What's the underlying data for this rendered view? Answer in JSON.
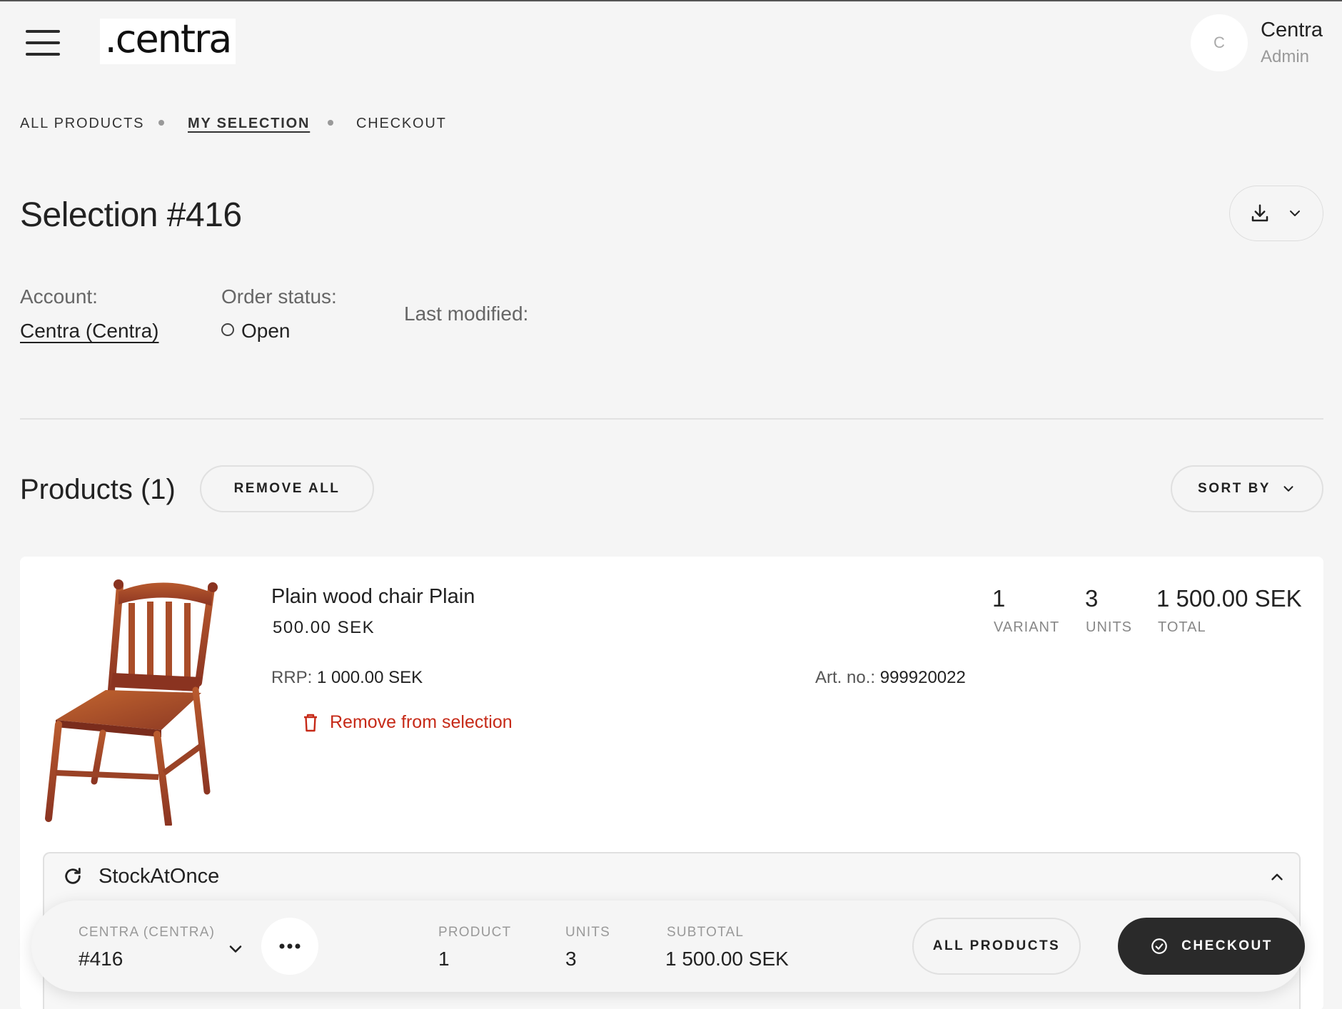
{
  "header": {
    "logo_text": ".centra",
    "avatar_initial": "C",
    "user_name": "Centra",
    "user_role": "Admin"
  },
  "breadcrumb": [
    {
      "label": "ALL PRODUCTS",
      "active": false
    },
    {
      "label": "MY SELECTION",
      "active": true
    },
    {
      "label": "CHECKOUT",
      "active": false
    }
  ],
  "page": {
    "title": "Selection #416"
  },
  "meta": {
    "account_label": "Account:",
    "account_value": "Centra (Centra)",
    "status_label": "Order status:",
    "status_value": "Open",
    "modified_label": "Last modified:"
  },
  "products": {
    "title": "Products (1)",
    "remove_all_label": "REMOVE ALL",
    "sort_by_label": "SORT BY",
    "items": [
      {
        "name": "Plain wood chair Plain",
        "price": "500.00 SEK",
        "rrp_label": "RRP:",
        "rrp_value": "1 000.00 SEK",
        "art_label": "Art. no.:",
        "art_value": "999920022",
        "remove_label": "Remove from selection",
        "variant_count": "1",
        "variant_label": "VARIANT",
        "units_count": "3",
        "units_label": "UNITS",
        "total_value": "1 500.00 SEK",
        "total_label": "TOTAL",
        "stock_title": "StockAtOnce"
      }
    ]
  },
  "bottom_bar": {
    "selection_label": "CENTRA (CENTRA)",
    "selection_value": "#416",
    "product_label": "PRODUCT",
    "product_value": "1",
    "units_label": "UNITS",
    "units_value": "3",
    "subtotal_label": "SUBTOTAL",
    "subtotal_value": "1 500.00 SEK",
    "all_products_label": "ALL PRODUCTS",
    "checkout_label": "CHECKOUT"
  },
  "colors": {
    "background": "#f5f5f5",
    "danger": "#c62a18",
    "primary_dark": "#2a2a2a"
  },
  "icons": [
    "menu-icon",
    "download-icon",
    "chevron-down-icon",
    "trash-icon",
    "refresh-icon",
    "chevron-up-icon",
    "more-icon",
    "check-circle-icon"
  ]
}
